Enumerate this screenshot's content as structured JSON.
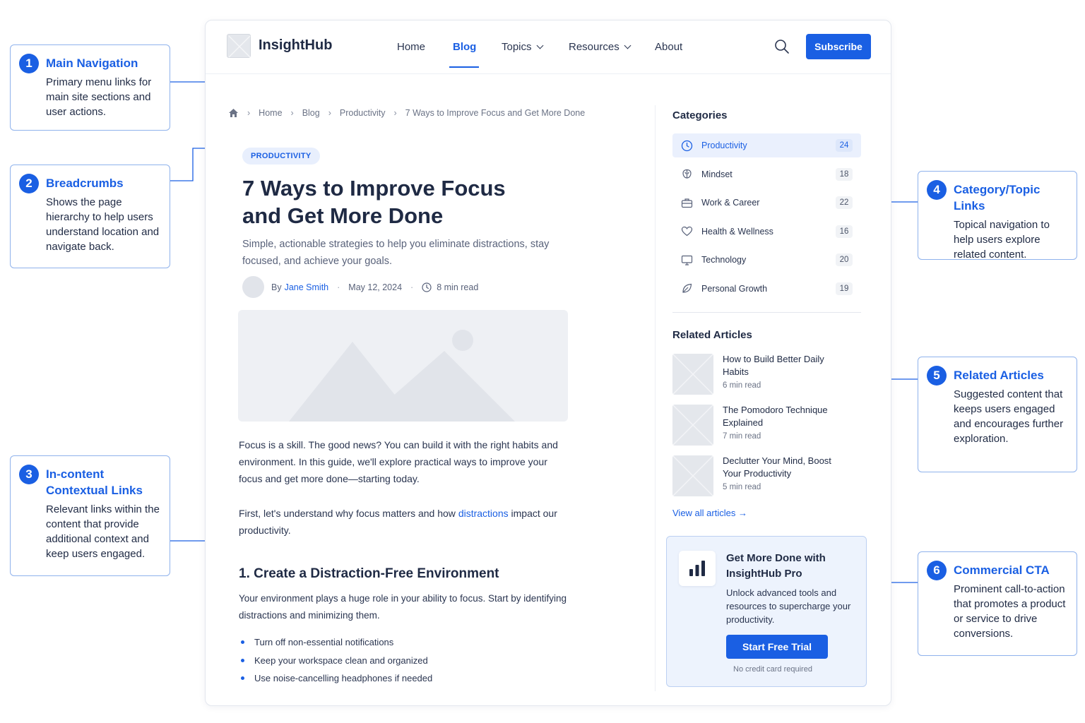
{
  "brand": {
    "name": "InsightHub"
  },
  "nav": {
    "items": [
      {
        "label": "Home"
      },
      {
        "label": "Blog"
      },
      {
        "label": "Topics"
      },
      {
        "label": "Resources"
      },
      {
        "label": "About"
      }
    ],
    "active": "Blog",
    "subscribe_label": "Subscribe"
  },
  "breadcrumb": [
    "Home",
    "Blog",
    "Productivity",
    "7 Ways to Improve Focus and Get More Done"
  ],
  "article": {
    "tag": "PRODUCTIVITY",
    "title_line1": "7 Ways to Improve Focus",
    "title_line2": "and Get More Done",
    "subtitle": "Simple, actionable strategies to help you eliminate distractions, stay focused, and achieve your goals.",
    "by": "By",
    "author": "Jane Smith",
    "date": "May 12, 2024",
    "read_time": "8 min read",
    "para1": "Focus is a skill. The good news? You can build it with the right habits and environment. In this guide, we'll explore practical ways to improve your focus and get more done—starting today.",
    "para2_before": "First, let's understand why focus matters and how ",
    "para2_link": "distractions",
    "para2_after": " impact our productivity.",
    "h2": "1. Create a Distraction-Free Environment",
    "para3": "Your environment plays a huge role in your ability to focus. Start by identifying distractions and minimizing them.",
    "bullets": [
      "Turn off non-essential notifications",
      "Keep your workspace clean and organized",
      "Use noise-cancelling headphones if needed"
    ]
  },
  "sidebar": {
    "categories_heading": "Categories",
    "categories": [
      {
        "label": "Productivity",
        "count": "24",
        "icon": "clock-icon"
      },
      {
        "label": "Mindset",
        "count": "18",
        "icon": "brain-icon"
      },
      {
        "label": "Work & Career",
        "count": "22",
        "icon": "briefcase-icon"
      },
      {
        "label": "Health & Wellness",
        "count": "16",
        "icon": "heart-icon"
      },
      {
        "label": "Technology",
        "count": "20",
        "icon": "monitor-icon"
      },
      {
        "label": "Personal Growth",
        "count": "19",
        "icon": "leaf-icon"
      }
    ],
    "related_heading": "Related Articles",
    "related": [
      {
        "title": "How to Build Better Daily Habits",
        "time": "6 min read"
      },
      {
        "title": "The Pomodoro Technique Explained",
        "time": "7 min read"
      },
      {
        "title": "Declutter Your Mind, Boost Your Productivity",
        "time": "5 min read"
      }
    ],
    "view_all": "View all articles →",
    "cta": {
      "title": "Get More Done with InsightHub Pro",
      "desc": "Unlock advanced tools and resources to supercharge your productivity.",
      "button": "Start Free Trial",
      "note": "No credit card required"
    }
  },
  "callouts": [
    {
      "num": "1",
      "title": "Main Navigation",
      "desc": "Primary menu links for main site sections and user actions."
    },
    {
      "num": "2",
      "title": "Breadcrumbs",
      "desc": "Shows the page hierarchy to help users understand location and navigate back."
    },
    {
      "num": "3",
      "title": "In-content Contextual Links",
      "desc": "Relevant links within the content that provide additional context and keep users engaged."
    },
    {
      "num": "4",
      "title": "Category/Topic Links",
      "desc": "Topical navigation to help users explore related content."
    },
    {
      "num": "5",
      "title": "Related Articles",
      "desc": "Suggested content that keeps users engaged and encourages further exploration."
    },
    {
      "num": "6",
      "title": "Commercial CTA",
      "desc": "Prominent call-to-action that promotes a product or service to drive conversions."
    }
  ],
  "colors": {
    "accent": "#1a5fe3",
    "callout_border": "#8fb2ec",
    "text": "#1f2a44"
  }
}
